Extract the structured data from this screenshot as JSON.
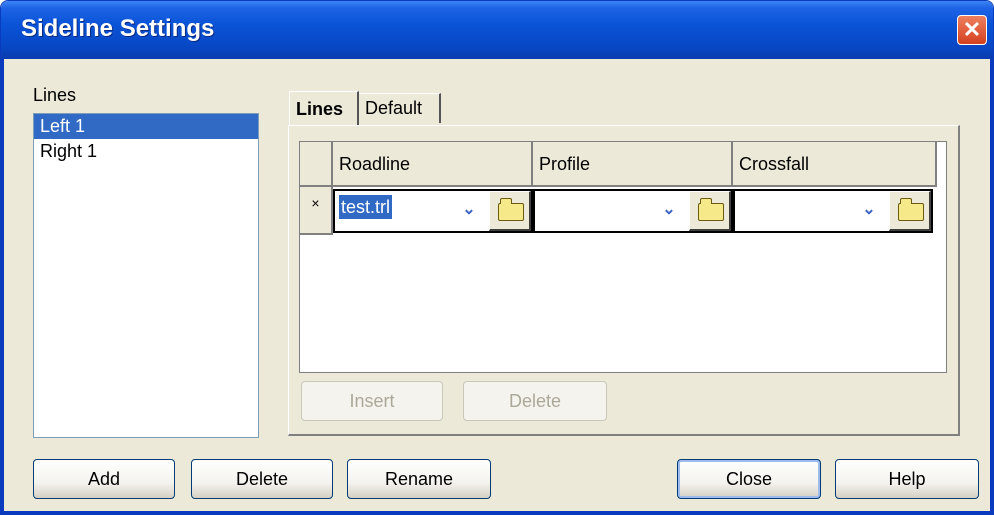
{
  "window": {
    "title": "Sideline Settings",
    "close_glyph": "✕"
  },
  "lines_label": "Lines",
  "lines_list": [
    {
      "label": "Left 1",
      "selected": true
    },
    {
      "label": "Right 1",
      "selected": false
    }
  ],
  "tabs": [
    {
      "label": "Lines",
      "active": true
    },
    {
      "label": "Default",
      "active": false
    }
  ],
  "grid": {
    "columns": [
      "Roadline",
      "Profile",
      "Crossfall"
    ],
    "row_marker": "×",
    "row": {
      "roadline": "test.trl",
      "profile": "",
      "crossfall": ""
    }
  },
  "grid_buttons": {
    "insert": "Insert",
    "delete": "Delete"
  },
  "bottom_buttons": {
    "add": "Add",
    "delete": "Delete",
    "rename": "Rename",
    "close": "Close",
    "help": "Help"
  },
  "colors": {
    "title_bar": "#0a53d7",
    "selection": "#316ac5",
    "face": "#ece9d8"
  }
}
